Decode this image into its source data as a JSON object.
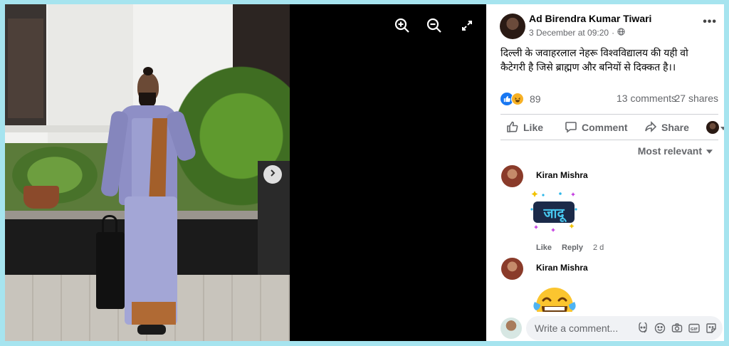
{
  "viewer": {
    "zoom_in_icon": "zoom-in-icon",
    "zoom_out_icon": "zoom-out-icon",
    "fullscreen_icon": "expand-icon",
    "next_icon": "chevron-right-icon"
  },
  "post": {
    "author": "Ad Birendra Kumar Tiwari",
    "date": "3 December at 09:20",
    "visibility_icon": "globe-icon",
    "text": "दिल्ली के जवाहरलाल नेहरू विश्वविद्यालय की यही वो कैटेगरी है जिसे ब्राह्मण और बनियों से दिक्कत है।।",
    "reaction_count": "89",
    "comments_count": "13 comments",
    "shares_count": "27 shares"
  },
  "actions": {
    "like": "Like",
    "comment": "Comment",
    "share": "Share"
  },
  "sort": {
    "label": "Most relevant"
  },
  "comments": [
    {
      "name": "Kiran Mishra",
      "sticker_text": "जादू",
      "like": "Like",
      "reply": "Reply",
      "time": "2 d"
    },
    {
      "name": "Kiran Mishra",
      "sticker": "laughing-tears-emoji"
    }
  ],
  "composer": {
    "placeholder": "Write a comment..."
  },
  "colors": {
    "page_background": "#a6e4ef",
    "facebook_blue": "#1877f2",
    "secondary_text": "#65676b"
  }
}
